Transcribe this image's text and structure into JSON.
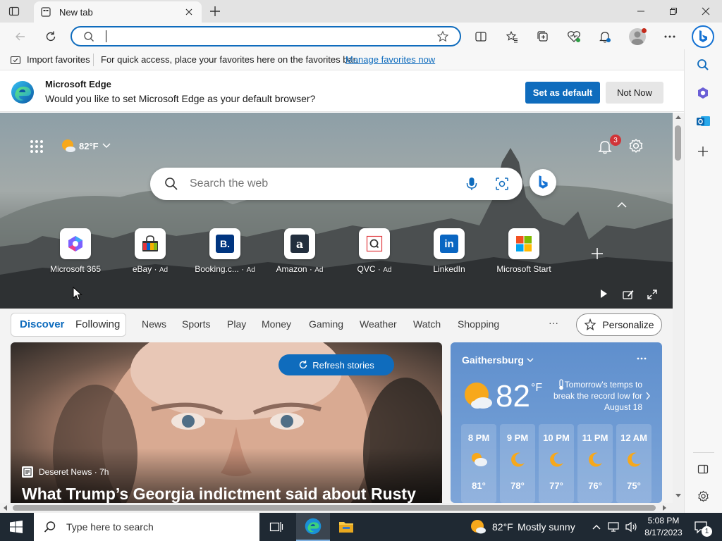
{
  "browser": {
    "tab_title": "New tab",
    "address_placeholder": "",
    "favorites_bar": {
      "import_label": "Import favorites",
      "message": "For quick access, place your favorites here on the favorites bar.",
      "manage_link": "Manage favorites now"
    },
    "default_prompt": {
      "title": "Microsoft Edge",
      "message": "Would you like to set Microsoft Edge as your default browser?",
      "primary_label": "Set as default",
      "secondary_label": "Not Now"
    }
  },
  "newtab": {
    "weather_chip": "82°F",
    "notifications_count": "3",
    "search_placeholder": "Search the web",
    "quick_links": [
      {
        "label": "Microsoft 365",
        "ad": "",
        "icon": "microsoft365-icon"
      },
      {
        "label": "eBay",
        "ad": "Ad",
        "icon": "ebay-icon"
      },
      {
        "label": "Booking.c...",
        "ad": "Ad",
        "icon": "booking-icon"
      },
      {
        "label": "Amazon",
        "ad": "Ad",
        "icon": "amazon-icon"
      },
      {
        "label": "QVC",
        "ad": "Ad",
        "icon": "qvc-icon"
      },
      {
        "label": "LinkedIn",
        "ad": "",
        "icon": "linkedin-icon"
      },
      {
        "label": "Microsoft Start",
        "ad": "",
        "icon": "microsoft-start-icon"
      }
    ],
    "feed_nav": {
      "discover": "Discover",
      "following": "Following",
      "items": [
        "News",
        "Sports",
        "Play",
        "Money",
        "Gaming",
        "Weather",
        "Watch",
        "Shopping"
      ],
      "more": "···",
      "personalize": "Personalize"
    },
    "hero_story": {
      "refresh_label": "Refresh stories",
      "source": "Deseret News · 7h",
      "headline": "What Trump’s Georgia indictment said about Rusty"
    },
    "weather_card": {
      "location": "Gaithersburg",
      "temp": "82",
      "unit": "°F",
      "note": "Tomorrow's temps to break the record low for August 18",
      "hours": [
        {
          "time": "8 PM",
          "temp": "81°",
          "icon": "partly-cloudy-night-icon"
        },
        {
          "time": "9 PM",
          "temp": "78°",
          "icon": "moon-icon"
        },
        {
          "time": "10 PM",
          "temp": "77°",
          "icon": "moon-icon"
        },
        {
          "time": "11 PM",
          "temp": "76°",
          "icon": "moon-icon"
        },
        {
          "time": "12 AM",
          "temp": "75°",
          "icon": "moon-icon"
        }
      ]
    }
  },
  "taskbar": {
    "search_placeholder": "Type here to search",
    "weather": "82°F",
    "condition": "Mostly sunny",
    "time": "5:08 PM",
    "date": "8/17/2023",
    "notif_count": "1"
  },
  "colors": {
    "accent": "#0f6cbd",
    "taskbar": "#1f2933",
    "titlebar": "#e3e3e3"
  }
}
